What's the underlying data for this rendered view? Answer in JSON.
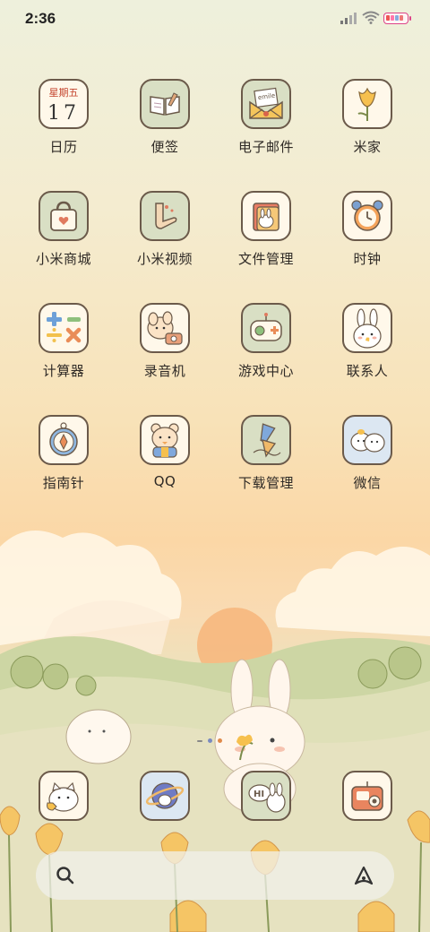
{
  "status_bar": {
    "time": "2:36"
  },
  "apps": [
    {
      "id": "calendar",
      "label": "日历",
      "weekday": "星期五",
      "day": "17"
    },
    {
      "id": "notes",
      "label": "便签"
    },
    {
      "id": "email",
      "label": "电子邮件",
      "envelope_text": "emile"
    },
    {
      "id": "mijia",
      "label": "米家"
    },
    {
      "id": "mi-store",
      "label": "小米商城"
    },
    {
      "id": "mi-video",
      "label": "小米视频"
    },
    {
      "id": "file-manager",
      "label": "文件管理"
    },
    {
      "id": "clock",
      "label": "时钟"
    },
    {
      "id": "calculator",
      "label": "计算器"
    },
    {
      "id": "recorder",
      "label": "录音机"
    },
    {
      "id": "game-center",
      "label": "游戏中心"
    },
    {
      "id": "contacts",
      "label": "联系人"
    },
    {
      "id": "compass",
      "label": "指南针"
    },
    {
      "id": "qq",
      "label": "QQ"
    },
    {
      "id": "downloads",
      "label": "下载管理"
    },
    {
      "id": "wechat",
      "label": "微信"
    }
  ],
  "dock": [
    {
      "id": "phone",
      "icon": "cat-phone-icon"
    },
    {
      "id": "browser",
      "icon": "planet-icon"
    },
    {
      "id": "messages",
      "icon": "hi-bubble-icon",
      "bubble_text": "HI"
    },
    {
      "id": "camera",
      "icon": "camera-icon"
    }
  ],
  "colors": {
    "label": "#2f2a26",
    "icon_border": "#6b5a4a",
    "calendar_red": "#c4442d"
  }
}
